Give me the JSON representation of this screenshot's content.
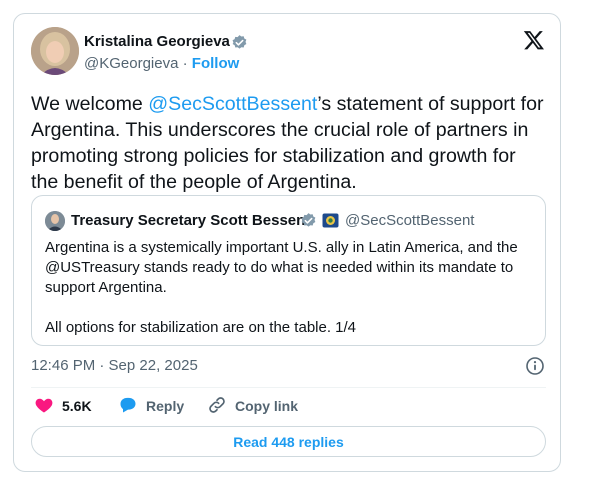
{
  "author": {
    "name": "Kristalina Georgieva",
    "handle": "@KGeorgieva",
    "separator": "·",
    "follow_label": "Follow"
  },
  "tweet": {
    "text_before": "We welcome ",
    "mention": "@SecScottBessent",
    "text_after": "’s statement of support for Argentina. This underscores the crucial role of partners in promoting strong policies for stabilization and growth for the benefit of the people of Argentina."
  },
  "quoted": {
    "name": "Treasury Secretary Scott Bessent",
    "handle": "@SecScottBessent",
    "body": "Argentina is a systemically important U.S. ally in Latin America, and the @USTreasury stands ready to do what is needed within its mandate to support Argentina.\n\nAll options for stabilization are on the table. 1/4"
  },
  "meta": {
    "timestamp": "12:46 PM · Sep 22, 2025"
  },
  "actions": {
    "likes": "5.6K",
    "reply_label": "Reply",
    "copy_label": "Copy link"
  },
  "replies_button": "Read 448 replies",
  "colors": {
    "accent": "#1d9bf0",
    "like": "#f91880",
    "muted": "#536471",
    "verified": "#829aab"
  },
  "icons": [
    "x-logo-icon",
    "verified-badge-icon",
    "flag-icon",
    "info-icon",
    "heart-icon",
    "reply-bubble-icon",
    "link-icon"
  ]
}
